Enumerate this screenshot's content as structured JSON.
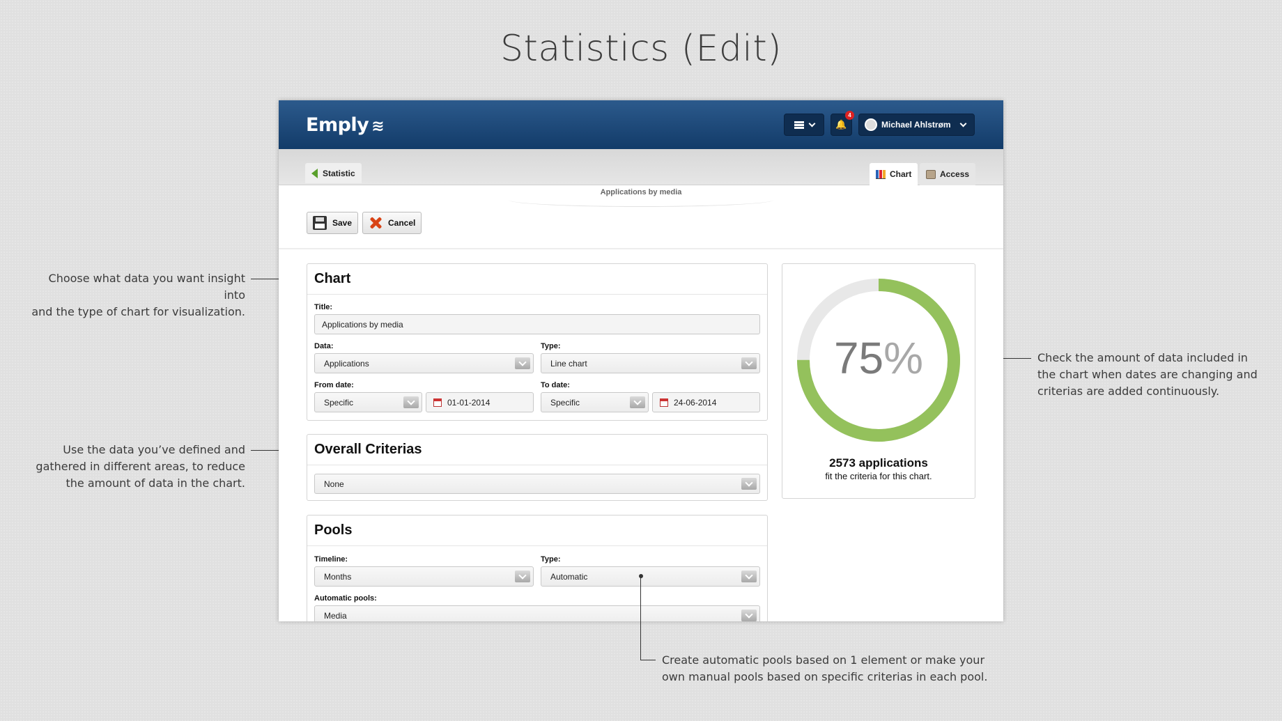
{
  "page_title": "Statistics (Edit)",
  "annotations": {
    "chart_note": [
      "Choose what data you want insight into",
      "and the type of chart for visualization."
    ],
    "criteria_note": [
      "Use the data you’ve defined and",
      "gathered in different areas, to reduce",
      "the amount of data in the chart."
    ],
    "gauge_note": [
      "Check the amount of data included in",
      "the chart when dates are changing and",
      "criterias are added continuously."
    ],
    "pools_note": [
      "Create automatic pools based on 1 element or make your",
      "own manual pools based on specific criterias in each pool."
    ]
  },
  "app": {
    "logo": "Emply",
    "notification_count": "4",
    "user_name": "Michael Ahlstrøm",
    "back_label": "Statistic",
    "tabs": [
      {
        "label": "Chart"
      },
      {
        "label": "Access"
      }
    ],
    "subtitle": "Applications by media",
    "save_label": "Save",
    "cancel_label": "Cancel"
  },
  "chart_panel": {
    "heading": "Chart",
    "title_label": "Title:",
    "title_value": "Applications by media",
    "data_label": "Data:",
    "data_value": "Applications",
    "type_label": "Type:",
    "type_value": "Line chart",
    "from_label": "From date:",
    "from_mode": "Specific",
    "from_date": "01-01-2014",
    "to_label": "To date:",
    "to_mode": "Specific",
    "to_date": "24-06-2014"
  },
  "criteria_panel": {
    "heading": "Overall Criterias",
    "value": "None"
  },
  "pools_panel": {
    "heading": "Pools",
    "timeline_label": "Timeline:",
    "timeline_value": "Months",
    "type_label": "Type:",
    "type_value": "Automatic",
    "auto_label": "Automatic pools:",
    "auto_value": "Media"
  },
  "stats": {
    "percent": 75,
    "percent_number": "75",
    "percent_symbol": "%",
    "count_text": "2573 applications",
    "sub_text": "fit the criteria for this chart.",
    "fill_color": "#94c15c",
    "track_color": "#e8e8e8"
  }
}
